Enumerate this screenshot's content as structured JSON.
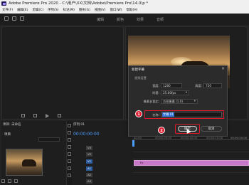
{
  "app": {
    "title": "Adobe Premiere Pro 2020 - C:\\用户\\XX\\文档\\Adobe\\Premiere Pro\\14.0\\p *"
  },
  "menu": [
    "文件(F)",
    "编辑(E)",
    "剪辑(C)",
    "序列(S)",
    "标记(M)",
    "图形(G)",
    "视图(V)",
    "窗口(W)",
    "帮助(H)"
  ],
  "workspace_tabs": [
    {
      "label": "编辑",
      "active": false
    },
    {
      "label": "颜色",
      "active": false
    },
    {
      "label": "效果",
      "active": false
    },
    {
      "label": "音频",
      "active": false
    }
  ],
  "project": {
    "tab": "项目: 未命名",
    "sequence_name": "项目",
    "search_placeholder": ""
  },
  "timeline": {
    "tab": "序列 01",
    "timecode": "00:00:00:00",
    "ruler_labels": [
      "00:00",
      "00:00:05:00",
      "00:00:10:00",
      "00:00:15:00",
      "00:00:20:00"
    ],
    "tracks": [
      "V3",
      "V2",
      "V1",
      "A1",
      "A2",
      "A3"
    ],
    "clip_label": "Fx"
  },
  "dialog": {
    "title": "新建字幕",
    "section": "视频设置",
    "width_label": "宽度:",
    "width_value": "1280",
    "height_label": "高度:",
    "height_value": "720",
    "timebase_label": "时基:",
    "timebase_value": "25.00fps",
    "pixel_aspect_label": "像素长宽比:",
    "pixel_aspect_value": "方形像素 (1.0)",
    "name_label": "名称:",
    "name_value": "字幕 01",
    "ok_label": "确定",
    "cancel_label": "取消"
  },
  "annotations": {
    "step1": "1",
    "step2": "2",
    "highlight_color": "#e0192d"
  }
}
